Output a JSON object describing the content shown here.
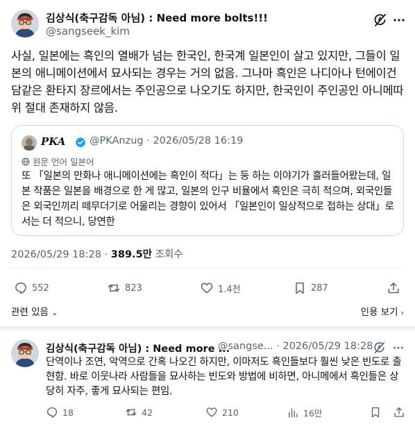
{
  "main_tweet": {
    "display_name": "김상식(축구감독 아님) : Need more bolts!!!",
    "handle": "@sangseek_kim",
    "text": "사실, 일본에는 흑인의 열배가 넘는 한국인, 한국계 일본인이 살고 있지만, 그들이 일본의 애니메이션에서 묘사되는 경우는 거의 없음. 그나마 흑인은 나디아나 턴에이건담같은 환타지 장르에서는 주인공으로 나오기도 하지만, 한국인이 주인공인 아니메따위 절대 존재하지 않음.",
    "timestamp": "2026/05/29 18:28 · ",
    "views_count": "389.5만",
    "views_label": " 조회수",
    "actions": {
      "replies": "552",
      "reposts": "823",
      "likes": "1.4천",
      "bookmarks": "287"
    },
    "related_label": "관련 있음",
    "quotes_label": "인용 보기"
  },
  "quoted_tweet": {
    "display_name": "PKA",
    "meta": "@PKAnzug · 2026/05/28 16:19",
    "original_language": "원문 언어 일본어",
    "text": "또 「일본의 만화나 애니메이션에는 흑인이 적다」는 둥 하는 이야기가 흘러들어왔는데, 일본 작품은 일본을 배경으로 한 게 많고, 일본의 인구 비율에서 흑인은 극히 적으며, 외국인들은 외국인끼리 떼무더기로 어울리는 경향이 있어서 「일본인이 일상적으로 접하는 상대」로서는 더 적으니, 당연한"
  },
  "reply_tweet": {
    "display_name": "김상식(축구감독 아님) : Need more ...",
    "meta": "@sangse... · 2026/05/29 18:28",
    "text": "단역이나 조연, 악역으로 간혹 나오긴 하지만, 이마저도 흑인들보다 훨씬 낮은 빈도로 출현함. 바로 이웃나라 사람들을 묘사하는 빈도와 방법에 비하면, 아니메에서 흑인들은 상당히 자주, 좋게 묘사되는 편임.",
    "actions": {
      "replies": "18",
      "reposts": "42",
      "likes": "210",
      "views": "16만"
    }
  },
  "colors": {
    "text": "#0f1419",
    "secondary": "#536471",
    "border": "#cfd9de",
    "divider": "#eff3f4",
    "verified": "#1d9bf0"
  },
  "icons": [
    "grok-icon",
    "reply-icon",
    "repost-icon",
    "like-icon",
    "bookmark-icon",
    "share-icon",
    "views-icon",
    "verified-badge-icon",
    "globe-icon"
  ]
}
